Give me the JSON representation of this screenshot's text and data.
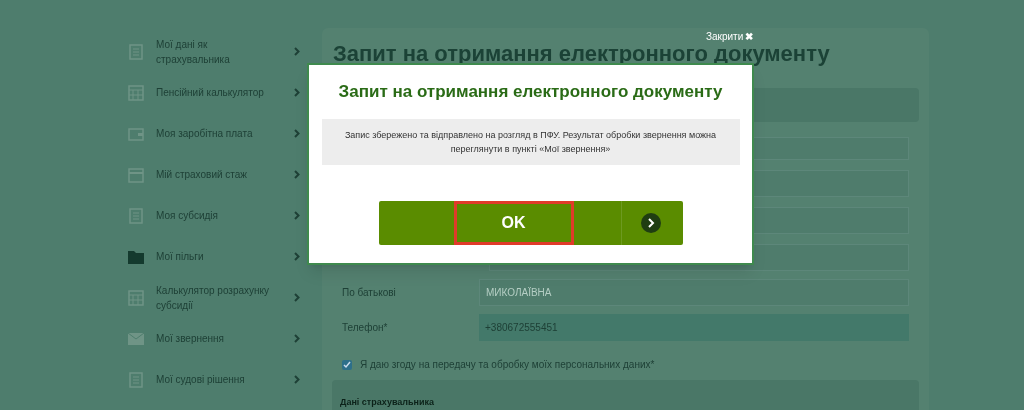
{
  "sidebar": {
    "items": [
      {
        "label": "Мої дані як страхувальника",
        "kind": "doc"
      },
      {
        "label": "Пенсійний калькулятор",
        "kind": "calc"
      },
      {
        "label": "Моя заробітна плата",
        "kind": "wallet"
      },
      {
        "label": "Мій страховий стаж",
        "kind": "calendar"
      },
      {
        "label": "Моя субсидія",
        "kind": "doc"
      },
      {
        "label": "Мої пільги",
        "kind": "folder"
      },
      {
        "label": "Калькулятор розрахунку субсидії",
        "kind": "calc"
      },
      {
        "label": "Мої звернення",
        "kind": "mail"
      },
      {
        "label": "Мої судові рішення",
        "kind": "doc"
      }
    ]
  },
  "page": {
    "title": "Запит на отримання електронного документу",
    "fields": [
      {
        "label": "По батькові",
        "value": "МИКОЛАЇВНА",
        "highlighted": false
      },
      {
        "label": "Телефон*",
        "value": "+380672555451",
        "highlighted": true
      }
    ],
    "consent": {
      "label": "Я даю згоду на передачу та обробку моїх персональних даних*",
      "checked": true
    },
    "section_title": "Дані страхувальника"
  },
  "modal": {
    "close_label": "Закрити",
    "close_glyph": "✖",
    "title": "Запит на отримання електронного документу",
    "message": "Запис збережено та відправлено на розгляд в ПФУ. Результат обробки звернення можна переглянути в пункті «Мої звернення»",
    "ok_label": "OK"
  }
}
